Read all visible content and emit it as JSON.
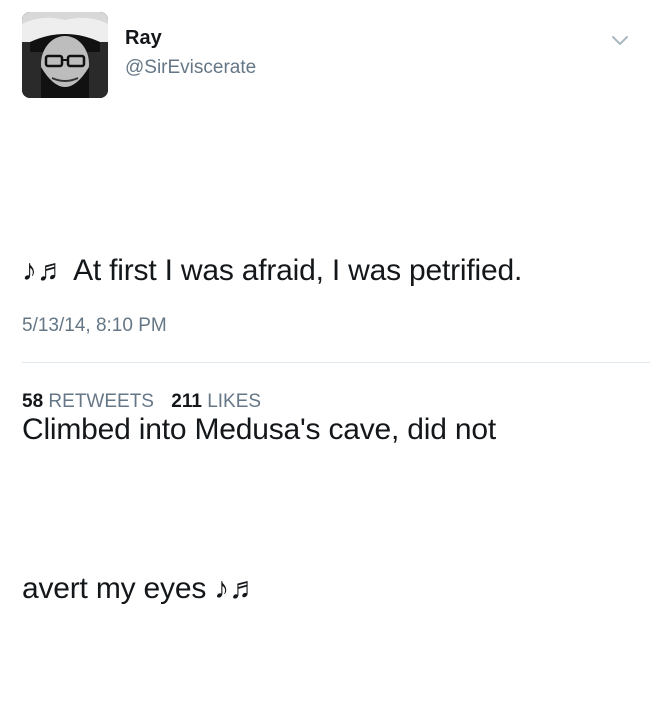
{
  "tweet": {
    "author": {
      "display_name": "Ray",
      "handle": "@SirEviscerate",
      "avatar_icon": "user-avatar-photo"
    },
    "menu_icon": "chevron-down-icon",
    "text_lines": [
      "♪♬ At first I was afraid, I was petrified.",
      "Climbed into Medusa's cave, did not",
      "avert my eyes ♪♬"
    ],
    "timestamp": "5/13/14, 8:10 PM",
    "stats": {
      "retweets_count": "58",
      "retweets_label": "RETWEETS",
      "likes_count": "211",
      "likes_label": "LIKES"
    }
  },
  "colors": {
    "text_primary": "#14171a",
    "text_secondary": "#657786",
    "divider": "#e1e8ed",
    "background": "#ffffff"
  }
}
